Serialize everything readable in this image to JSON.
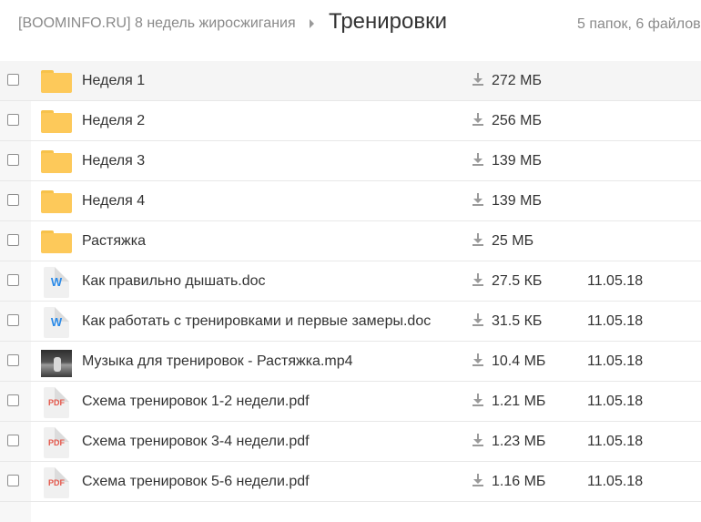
{
  "header": {
    "root": "[BOOMINFO.RU] 8 недель жиросжигания",
    "current": "Тренировки",
    "count": "5 папок, 6 файлов"
  },
  "colors": {
    "folder": "#fdc95a",
    "word": "#2a8ae8",
    "pdf": "#e4574b"
  },
  "rows": [
    {
      "type": "folder",
      "icon": "folder-icon",
      "name": "Неделя 1",
      "size": "272 МБ",
      "date": ""
    },
    {
      "type": "folder",
      "icon": "folder-icon",
      "name": "Неделя 2",
      "size": "256 МБ",
      "date": ""
    },
    {
      "type": "folder",
      "icon": "folder-icon",
      "name": "Неделя 3",
      "size": "139 МБ",
      "date": ""
    },
    {
      "type": "folder",
      "icon": "folder-icon",
      "name": "Неделя 4",
      "size": "139 МБ",
      "date": ""
    },
    {
      "type": "folder",
      "icon": "folder-icon",
      "name": "Растяжка",
      "size": "25 МБ",
      "date": ""
    },
    {
      "type": "word",
      "icon": "word-doc-icon",
      "badge": "W",
      "name": "Как правильно дышать.doc",
      "size": "27.5 КБ",
      "date": "11.05.18"
    },
    {
      "type": "word",
      "icon": "word-doc-icon",
      "badge": "W",
      "name": "Как работать с тренировками и первые замеры.doc",
      "size": "31.5 КБ",
      "date": "11.05.18"
    },
    {
      "type": "video",
      "icon": "video-thumbnail-icon",
      "name": "Музыка для тренировок - Растяжка.mp4",
      "size": "10.4 МБ",
      "date": "11.05.18"
    },
    {
      "type": "pdf",
      "icon": "pdf-icon",
      "badge": "PDF",
      "name": "Схема тренировок 1-2 недели.pdf",
      "size": "1.21 МБ",
      "date": "11.05.18"
    },
    {
      "type": "pdf",
      "icon": "pdf-icon",
      "badge": "PDF",
      "name": "Схема тренировок 3-4 недели.pdf",
      "size": "1.23 МБ",
      "date": "11.05.18"
    },
    {
      "type": "pdf",
      "icon": "pdf-icon",
      "badge": "PDF",
      "name": "Схема тренировок 5-6 недели.pdf",
      "size": "1.16 МБ",
      "date": "11.05.18"
    }
  ]
}
